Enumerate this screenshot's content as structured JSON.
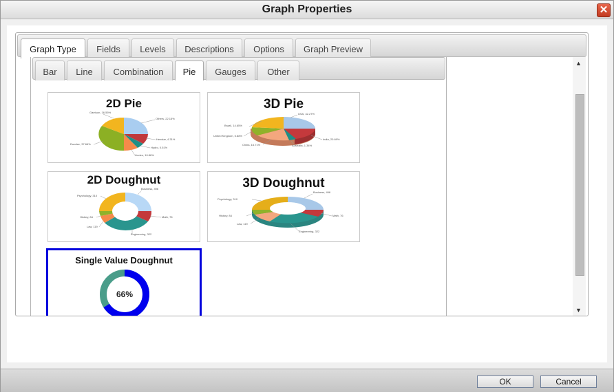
{
  "window": {
    "title": "Graph Properties",
    "close_glyph": "✕"
  },
  "tabs": [
    "Graph Type",
    "Fields",
    "Levels",
    "Descriptions",
    "Options",
    "Graph Preview"
  ],
  "subtabs": [
    "Bar",
    "Line",
    "Combination",
    "Pie",
    "Gauges",
    "Other"
  ],
  "cards": {
    "pie2d": {
      "title": "2D Pie",
      "labels": [
        "Garrison, 16.55%",
        "Others, 22.15%",
        "Henstar, 4.31%",
        "Hydro, 0.51%",
        "Linden, 10.86%",
        "Dundee, 37.66%"
      ]
    },
    "pie3d": {
      "title": "3D Pie",
      "labels": [
        "USA, 42.27%",
        "Brazil, 14.65%",
        "United Kingdom, 5.88%",
        "India, 20.69%",
        "China, 16.71%",
        "Australia, 1.34%"
      ]
    },
    "doughnut2d": {
      "title": "2D Doughnut",
      "labels": [
        "Business, 496",
        "Psychology, 310",
        "Math, 76",
        "History, 84",
        "Law, 119",
        "Engineering, 322"
      ]
    },
    "doughnut3d": {
      "title": "3D Doughnut",
      "labels": [
        "Business, 496",
        "Psychology, 310",
        "Math, 76",
        "History, 84",
        "Law, 119",
        "Engineering, 322"
      ]
    },
    "single": {
      "title": "Single Value Doughnut",
      "value_text": "66%",
      "value": 0.66
    }
  },
  "colors": {
    "selected_border": "#0000dd",
    "ring_value": "#0000ee",
    "ring_rest": "#4a9d8a"
  },
  "footer": {
    "ok": "OK",
    "cancel": "Cancel"
  },
  "icons": {
    "close": "close-icon",
    "scroll_up": "arrow-up-icon",
    "scroll_down": "arrow-down-icon"
  },
  "scroll_glyphs": {
    "up": "▲",
    "down": "▼"
  }
}
